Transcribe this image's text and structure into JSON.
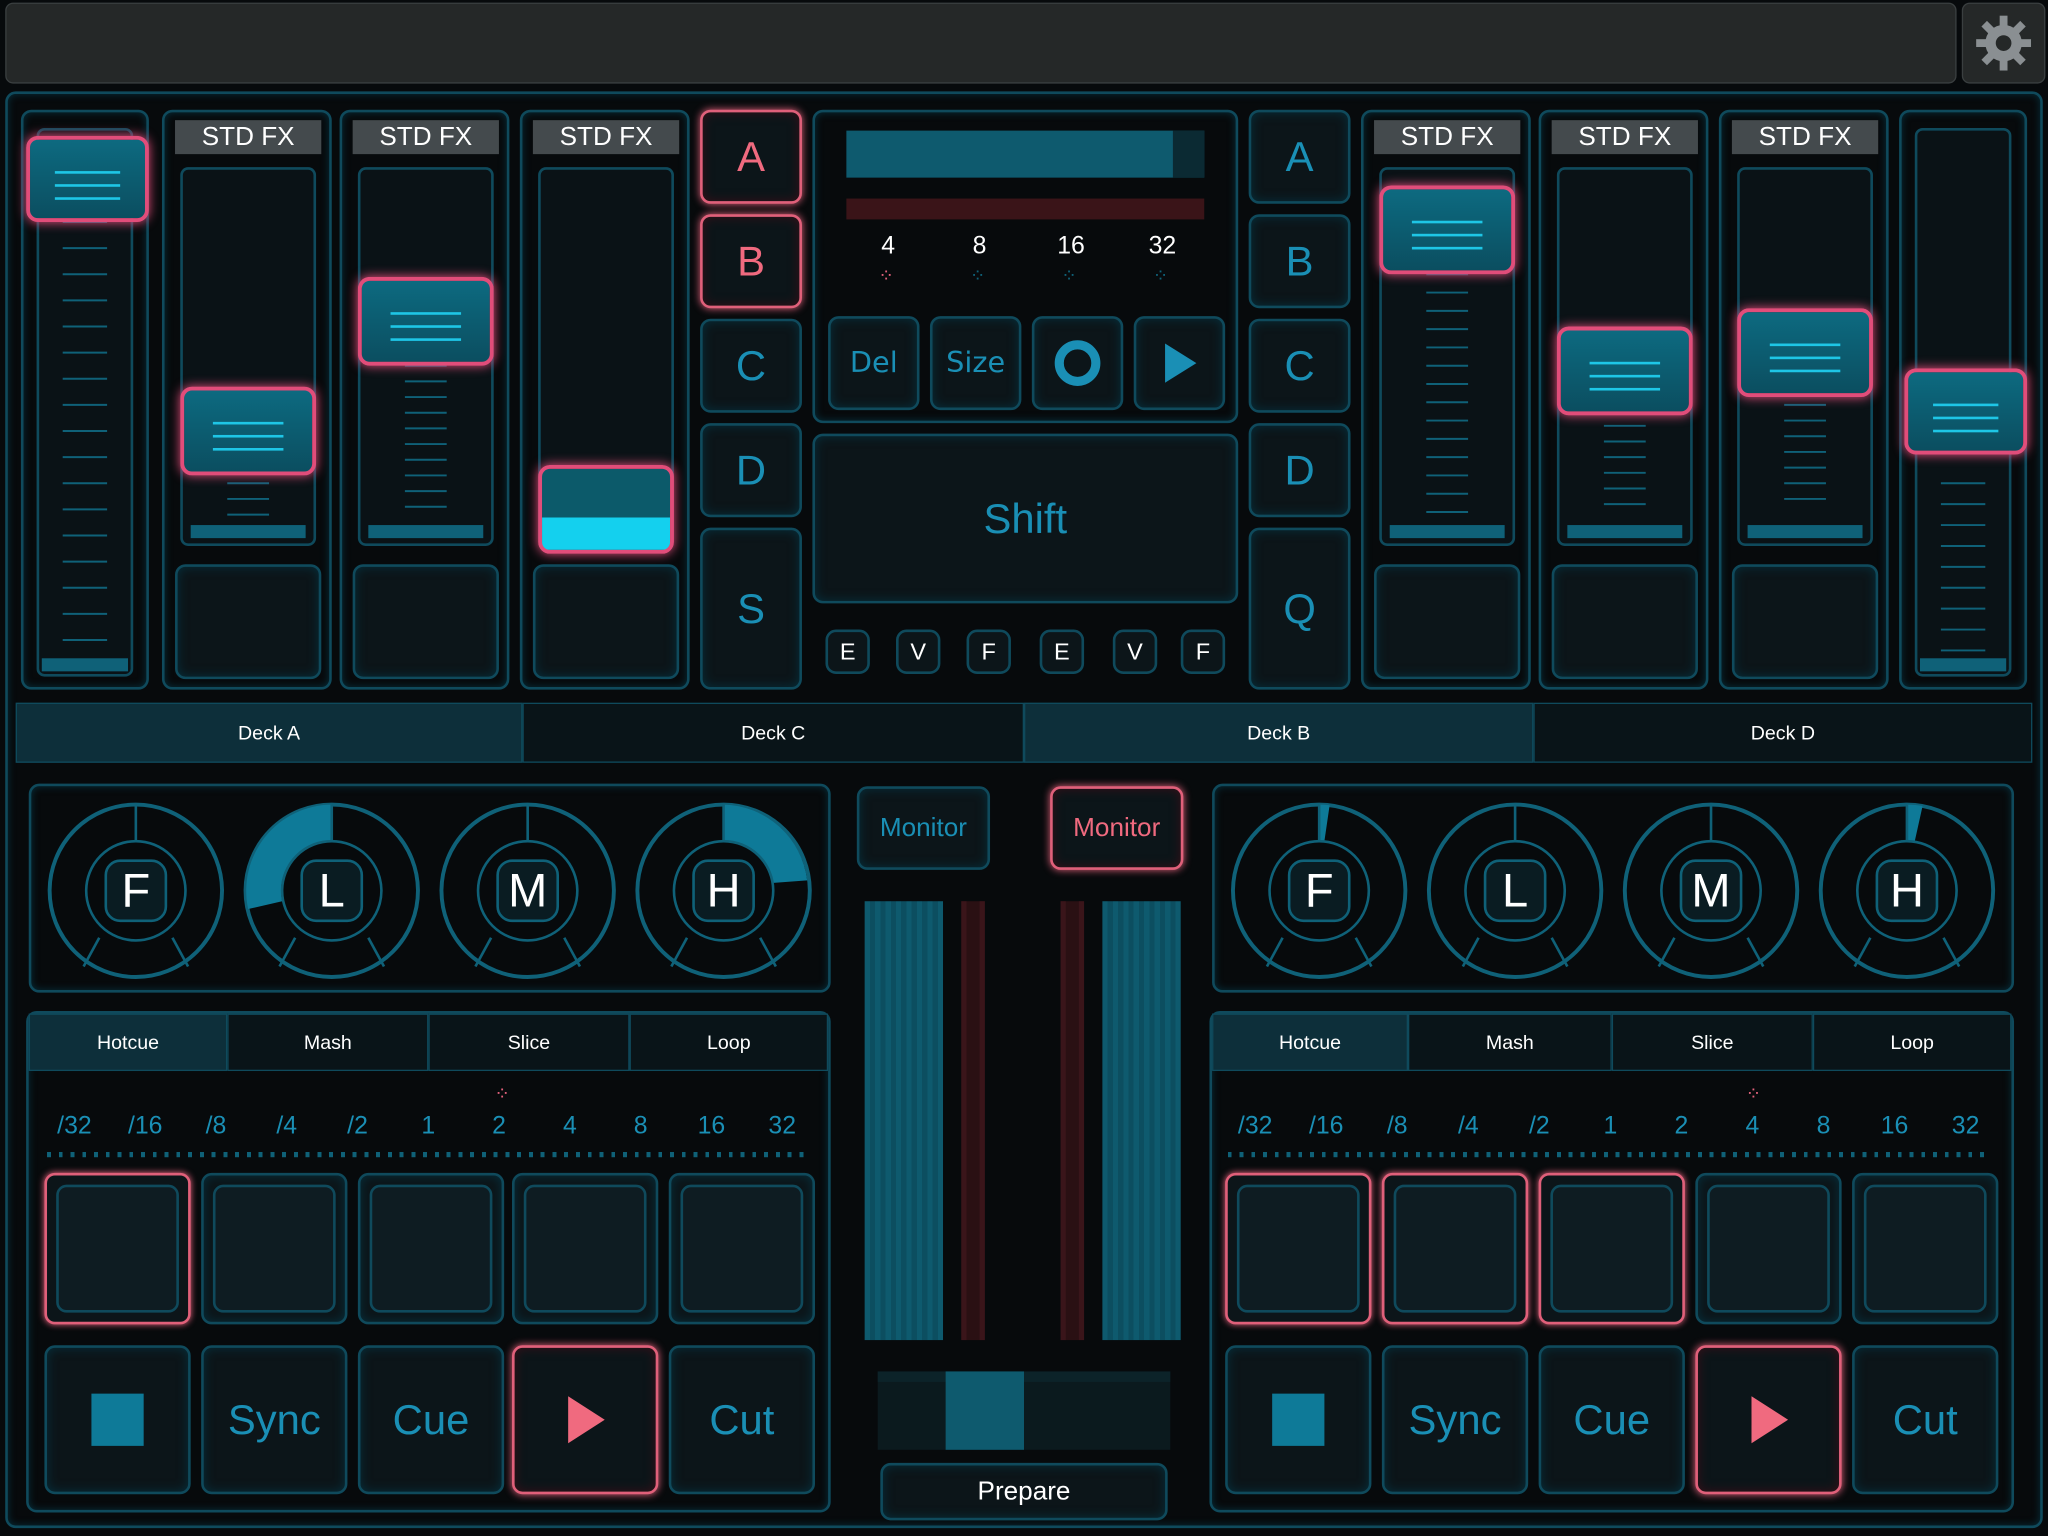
{
  "fx_label": "STD FX",
  "deck_buttons_left": [
    "A",
    "B",
    "C",
    "D",
    "S"
  ],
  "deck_buttons_right": [
    "A",
    "B",
    "C",
    "D",
    "Q"
  ],
  "loop_sizes": [
    "4",
    "8",
    "16",
    "32"
  ],
  "transport": {
    "del": "Del",
    "size": "Size"
  },
  "shift_label": "Shift",
  "evf_left": [
    "E",
    "V",
    "F"
  ],
  "evf_right": [
    "E",
    "V",
    "F"
  ],
  "deck_tabs": [
    "Deck A",
    "Deck C",
    "Deck B",
    "Deck D"
  ],
  "eq_knobs": [
    "F",
    "L",
    "M",
    "H"
  ],
  "monitor_label": "Monitor",
  "mode_tabs": [
    "Hotcue",
    "Mash",
    "Slice",
    "Loop"
  ],
  "beat_sizes": [
    "/32",
    "/16",
    "/8",
    "/4",
    "/2",
    "1",
    "2",
    "4",
    "8",
    "16",
    "32"
  ],
  "controls": {
    "sync": "Sync",
    "cue": "Cue",
    "cut": "Cut"
  },
  "prepare_label": "Prepare",
  "colors": {
    "accent": "#1a8fb5",
    "active": "#e0607a",
    "background": "#070a0c"
  },
  "icons": {
    "settings": "gear-icon",
    "stop": "stop-icon",
    "play": "play-icon",
    "record": "record-icon"
  }
}
